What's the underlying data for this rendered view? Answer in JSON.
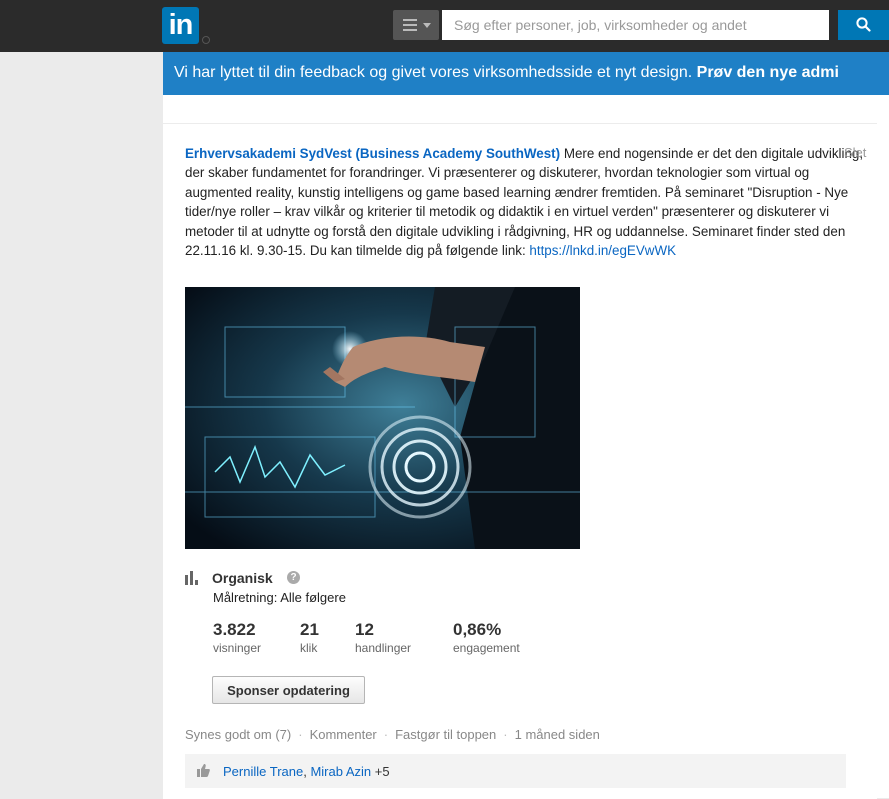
{
  "header": {
    "logo": "in",
    "search_placeholder": "Søg efter personer, job, virksomheder og andet"
  },
  "banner": {
    "text": "Vi har lyttet til din feedback og givet vores virksomhedsside et nyt design. ",
    "cta": "Prøv den nye admi"
  },
  "post": {
    "company": "Erhvervsakademi SydVest (Business Academy SouthWest)",
    "body": " Mere end nogensinde er det den digitale udvikling, der skaber fundamentet for forandringer. Vi præsenterer og diskuterer, hvordan teknologier som virtual og augmented reality, kunstig intelligens og game based learning ændrer fremtiden. På seminaret \"Disruption - Nye tider/nye roller – krav vilkår og kriterier til metodik og didaktik i en virtuel verden\" præsenterer og diskuterer vi metoder til at udnytte og forstå den digitale udvikling i rådgivning, HR og uddannelse. Seminaret finder sted den 22.11.16 kl. 9.30-15. Du kan tilmelde dig på følgende link: ",
    "link": "https://lnkd.in/egEVwWK",
    "delete_label": "Slet"
  },
  "stats": {
    "label": "Organisk",
    "help": "?",
    "targeting": "Målretning: Alle følgere",
    "metrics": [
      {
        "value": "3.822",
        "label": "visninger"
      },
      {
        "value": "21",
        "label": "klik"
      },
      {
        "value": "12",
        "label": "handlinger"
      },
      {
        "value": "0,86%",
        "label": "engagement"
      }
    ]
  },
  "sponsor_button": "Sponser opdatering",
  "actions": {
    "like": "Synes godt om (7)",
    "comment": "Kommenter",
    "pin": "Fastgør til toppen",
    "time": "1 måned siden"
  },
  "likes": {
    "person1": "Pernille Trane",
    "person2": "Mirab Azin",
    "more": "+5"
  },
  "colors": {
    "brand": "#0077b5",
    "banner": "#1f80c6",
    "link": "#0a66c2"
  }
}
